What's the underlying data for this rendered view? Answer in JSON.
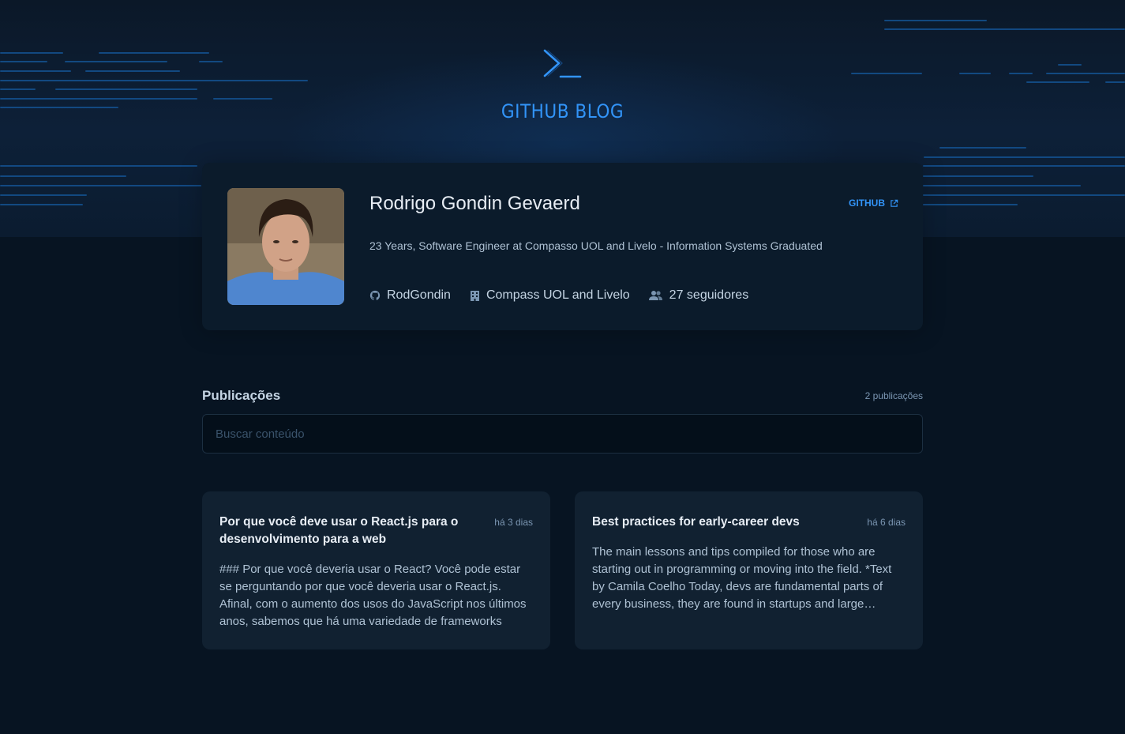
{
  "header": {
    "logo_title": "GITHUB BLOG"
  },
  "profile": {
    "name": "Rodrigo Gondin Gevaerd",
    "github_link": "GITHUB",
    "bio": "23 Years, Software Engineer at Compasso UOL and Livelo - Information Systems Graduated",
    "username": "RodGondin",
    "company": "Compass UOL and Livelo",
    "followers": "27 seguidores"
  },
  "publications": {
    "title": "Publicações",
    "count": "2 publicações",
    "search_placeholder": "Buscar conteúdo"
  },
  "posts": [
    {
      "title": "Por que você deve usar o React.js para o desenvolvimento para a web",
      "date": "há 3 dias",
      "excerpt": "### Por que você deveria usar o React? Você pode estar se perguntando por que você deveria usar o React.js. Afinal, com o aumento dos usos do JavaScript nos últimos anos, sabemos que há uma variedade de frameworks"
    },
    {
      "title": "Best practices for early-career devs",
      "date": "há 6 dias",
      "excerpt": "The main lessons and tips compiled for those who are starting out in programming or moving into the field. *Text by Camila Coelho Today, devs are fundamental parts of every business, they are found in startups and large companies"
    }
  ],
  "colors": {
    "accent": "#3294F8",
    "background": "#071422",
    "card": "#0B1B2B",
    "post_card": "#112131"
  }
}
